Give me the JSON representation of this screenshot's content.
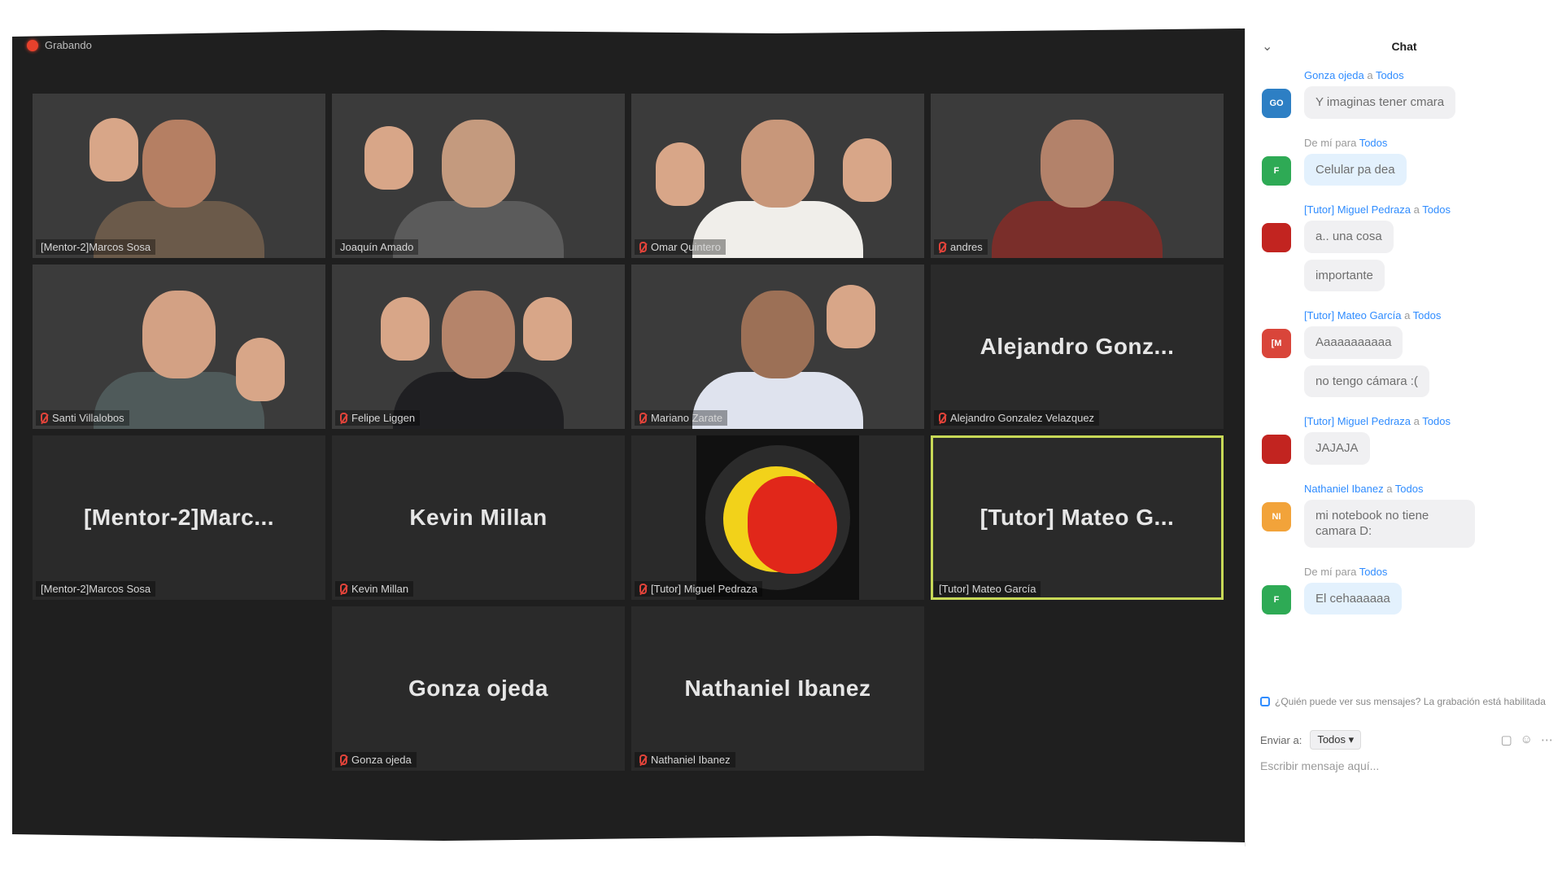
{
  "recording": {
    "label": "Grabando"
  },
  "tiles": [
    {
      "caption": "[Mentor-2]Marcos Sosa",
      "center": ""
    },
    {
      "caption": "Joaquín Amado",
      "center": ""
    },
    {
      "caption": "Omar Quintero",
      "center": ""
    },
    {
      "caption": "andres",
      "center": ""
    },
    {
      "caption": "Santi Villalobos",
      "center": ""
    },
    {
      "caption": "Felipe Liggen",
      "center": ""
    },
    {
      "caption": "Mariano Zarate",
      "center": ""
    },
    {
      "caption": "Alejandro Gonzalez Velazquez",
      "center": "Alejandro  Gonz..."
    },
    {
      "caption": "[Mentor-2]Marcos Sosa",
      "center": "[Mentor-2]Marc..."
    },
    {
      "caption": "Kevin Millan",
      "center": "Kevin Millan"
    },
    {
      "caption": "[Tutor] Miguel Pedraza",
      "center": ""
    },
    {
      "caption": "[Tutor] Mateo García",
      "center": "[Tutor]  Mateo  G..."
    },
    {
      "caption": "Gonza ojeda",
      "center": "Gonza ojeda"
    },
    {
      "caption": "Nathaniel Ibanez",
      "center": "Nathaniel Ibanez"
    }
  ],
  "chat": {
    "title": "Chat",
    "messages": [
      {
        "sender": "Gonza ojeda",
        "joiner": " a ",
        "to": "Todos",
        "avatar": "GO",
        "avatar_color": "#2d7fc4",
        "texts": [
          "Y imaginas tener cmara"
        ],
        "mine": false
      },
      {
        "sender": "",
        "joiner": "De mí para ",
        "to": "Todos",
        "avatar": "F",
        "avatar_color": "#2eaa55",
        "texts": [
          "Celular pa dea"
        ],
        "mine": true
      },
      {
        "sender": "[Tutor] Miguel Pedraza",
        "joiner": " a ",
        "to": "Todos",
        "avatar": "",
        "avatar_color": "#c22420",
        "texts": [
          "a.. una cosa",
          "importante"
        ],
        "mine": false
      },
      {
        "sender": "[Tutor] Mateo García",
        "joiner": " a ",
        "to": "Todos",
        "avatar": "[M",
        "avatar_color": "#d9453a",
        "texts": [
          "Aaaaaaaaaaa",
          "no tengo cámara :("
        ],
        "mine": false
      },
      {
        "sender": "[Tutor] Miguel Pedraza",
        "joiner": " a ",
        "to": "Todos",
        "avatar": "",
        "avatar_color": "#c22420",
        "texts": [
          "JAJAJA"
        ],
        "mine": false
      },
      {
        "sender": "Nathaniel Ibanez",
        "joiner": " a ",
        "to": "Todos",
        "avatar": "NI",
        "avatar_color": "#f2a33a",
        "texts": [
          "mi notebook no tiene camara D:"
        ],
        "mine": false
      },
      {
        "sender": "",
        "joiner": "De mí para ",
        "to": "Todos",
        "avatar": "F",
        "avatar_color": "#2eaa55",
        "texts": [
          "El cehaaaaaa"
        ],
        "mine": true
      }
    ],
    "privacy_note": "¿Quién puede ver sus mensajes? La grabación está habilitada",
    "send_to_label": "Enviar a:",
    "send_to_value": "Todos ▾",
    "input_placeholder": "Escribir mensaje aquí..."
  }
}
